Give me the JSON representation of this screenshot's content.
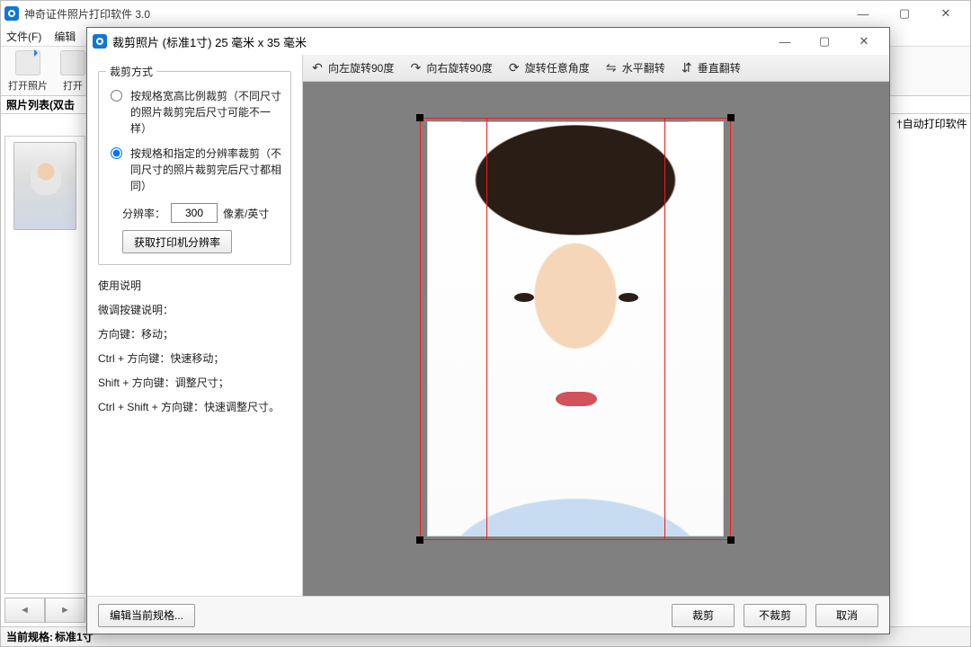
{
  "mainWindow": {
    "title": "神奇证件照片打印软件 3.0",
    "menu": {
      "file": "文件(F)",
      "edit": "编辑"
    },
    "toolbar": {
      "open": "打开照片",
      "openPartial": "打开"
    },
    "listHeader": "照片列表(双击",
    "rightBanner": "†自动打印软件",
    "status": {
      "label": "当前规格:",
      "value": "标准1寸"
    }
  },
  "dialog": {
    "title": "裁剪照片 (标准1寸) 25 毫米 x 35 毫米",
    "crop": {
      "groupTitle": "裁剪方式",
      "option1": "按规格宽高比例裁剪（不同尺寸的照片裁剪完后尺寸可能不一样）",
      "option2": "按规格和指定的分辨率裁剪（不同尺寸的照片裁剪完后尺寸都相同）",
      "resLabel": "分辨率：",
      "resValue": "300",
      "resUnit": "像素/英寸",
      "getPrinterRes": "获取打印机分辨率"
    },
    "instr": {
      "title": "使用说明",
      "l1": "微调按键说明：",
      "l2": "方向键：移动；",
      "l3": "Ctrl + 方向键：快速移动；",
      "l4": "Shift + 方向键：调整尺寸；",
      "l5": "Ctrl + Shift + 方向键：快速调整尺寸。"
    },
    "toolbar": {
      "rotL": "向左旋转90度",
      "rotR": "向右旋转90度",
      "rotAny": "旋转任意角度",
      "flipH": "水平翻转",
      "flipV": "垂直翻转"
    },
    "footer": {
      "editSpec": "编辑当前规格...",
      "crop": "裁剪",
      "noCrop": "不裁剪",
      "cancel": "取消"
    }
  }
}
